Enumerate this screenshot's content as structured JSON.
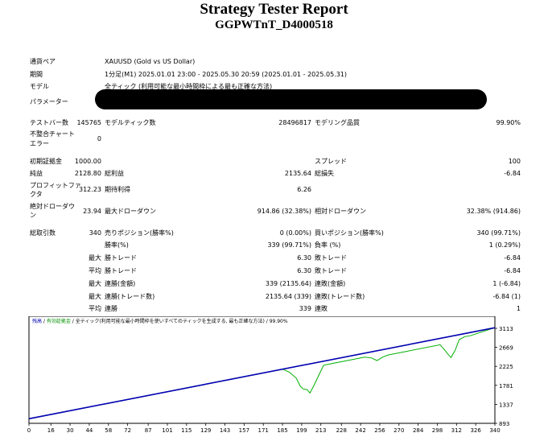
{
  "report": {
    "title": "Strategy Tester Report",
    "subtitle": "GGPWTnT_D4000518"
  },
  "settings": {
    "symbol_label": "通貨ペア",
    "symbol_value": "XAUUSD (Gold vs US Dollar)",
    "period_label": "期間",
    "period_value": "1分足(M1) 2025.01.01 23:00 - 2025.05.30 20:59 (2025.01.01 - 2025.05.31)",
    "model_label": "モデル",
    "model_value": "全ティック (利用可能な最小時間枠による最も正確な方法)",
    "params_label": "パラメーター"
  },
  "stats": {
    "bars_label": "テストバー数",
    "bars_value": "145765",
    "ticks_label": "モデルティック数",
    "ticks_value": "28496817",
    "quality_label": "モデリング品質",
    "quality_value": "99.90%",
    "mismatch_label_1": "不整合チャート",
    "mismatch_label_2": "エラー",
    "mismatch_value": "0",
    "deposit_label": "初期証拠金",
    "deposit_value": "1000.00",
    "spread_label": "スプレッド",
    "spread_value": "100",
    "net_label": "純益",
    "net_value": "2128.80",
    "gross_profit_label": "総利益",
    "gross_profit_value": "2135.64",
    "gross_loss_label": "総損失",
    "gross_loss_value": "-6.84",
    "pf_label_1": "プロフィットファ",
    "pf_label_2": "クタ",
    "pf_value": "312.23",
    "expected_label": "期待利得",
    "expected_value": "6.26",
    "abs_dd_label_1": "絶対ドローダウ",
    "abs_dd_label_2": "ン",
    "abs_dd_value": "23.94",
    "max_dd_label": "最大ドローダウン",
    "max_dd_value": "914.86 (32.38%)",
    "rel_dd_label": "相対ドローダウン",
    "rel_dd_value": "32.38% (914.86)",
    "total_trades_label": "総取引数",
    "total_trades_value": "340",
    "short_label": "売りポジション(勝率%)",
    "short_value": "0 (0.00%)",
    "long_label": "買いポジション(勝率%)",
    "long_value": "340 (99.71%)",
    "win_rate_label": "勝率(%)",
    "win_rate_value": "339 (99.71%)",
    "loss_rate_label": "負率 (%)",
    "loss_rate_value": "1 (0.29%)",
    "max_word": "最大",
    "avg_word": "平均",
    "largest_win_label": "勝トレード",
    "largest_win_value": "6.30",
    "largest_loss_label": "敗トレード",
    "largest_loss_value": "-6.84",
    "avg_win_label": "勝トレード",
    "avg_win_value": "6.30",
    "avg_loss_label": "敗トレード",
    "avg_loss_value": "-6.84",
    "max_cons_wins_label": "連勝(金額)",
    "max_cons_wins_value": "339 (2135.64)",
    "max_cons_losses_label": "連敗(金額)",
    "max_cons_losses_value": "1 (-6.84)",
    "max_cons_profit_label": "連勝(トレード数)",
    "max_cons_profit_value": "2135.64 (339)",
    "max_cons_loss_label": "連敗(トレード数)",
    "max_cons_loss_value": "-6.84 (1)",
    "avg_cons_wins_label": "連勝",
    "avg_cons_wins_value": "339",
    "avg_cons_losses_label": "連敗",
    "avg_cons_losses_value": "1"
  },
  "chart_legend": {
    "balance": "残高",
    "sep1": " / ",
    "equity": "有効証拠金",
    "sep2": " / ",
    "model": "全ティック(利用可能な最小時間枠を使いすべてのティックを生成する, 最も正確な方法)",
    "sep3": " / ",
    "quality": "99.90%"
  },
  "chart_data": {
    "type": "line",
    "x_ticks": [
      "0",
      "16",
      "30",
      "44",
      "58",
      "72",
      "87",
      "101",
      "115",
      "129",
      "143",
      "157",
      "171",
      "185",
      "199",
      "213",
      "228",
      "242",
      "256",
      "270",
      "284",
      "298",
      "312",
      "326",
      "340"
    ],
    "y_ticks": [
      "3113",
      "2669",
      "2225",
      "1781",
      "1337",
      "893"
    ],
    "xlim": [
      0,
      340
    ],
    "ylim": [
      893,
      3113
    ],
    "series": [
      {
        "color": "#0000b0",
        "x": [
          0,
          340
        ],
        "y": [
          1000,
          3128.8
        ]
      },
      {
        "color": "#00b000",
        "x": [
          0,
          60,
          100,
          150,
          185,
          190,
          195,
          198,
          200,
          203,
          205,
          208,
          212,
          215,
          220,
          245,
          250,
          254,
          258,
          262,
          300,
          303,
          306,
          308,
          311,
          314,
          318,
          322,
          340
        ],
        "y": [
          1000,
          1376,
          1626,
          1940,
          2159,
          2090,
          1950,
          1760,
          1700,
          1680,
          1600,
          1780,
          2050,
          2250,
          2284,
          2440,
          2420,
          2360,
          2440,
          2490,
          2730,
          2620,
          2500,
          2430,
          2600,
          2850,
          2920,
          2940,
          3128.8
        ]
      }
    ]
  }
}
